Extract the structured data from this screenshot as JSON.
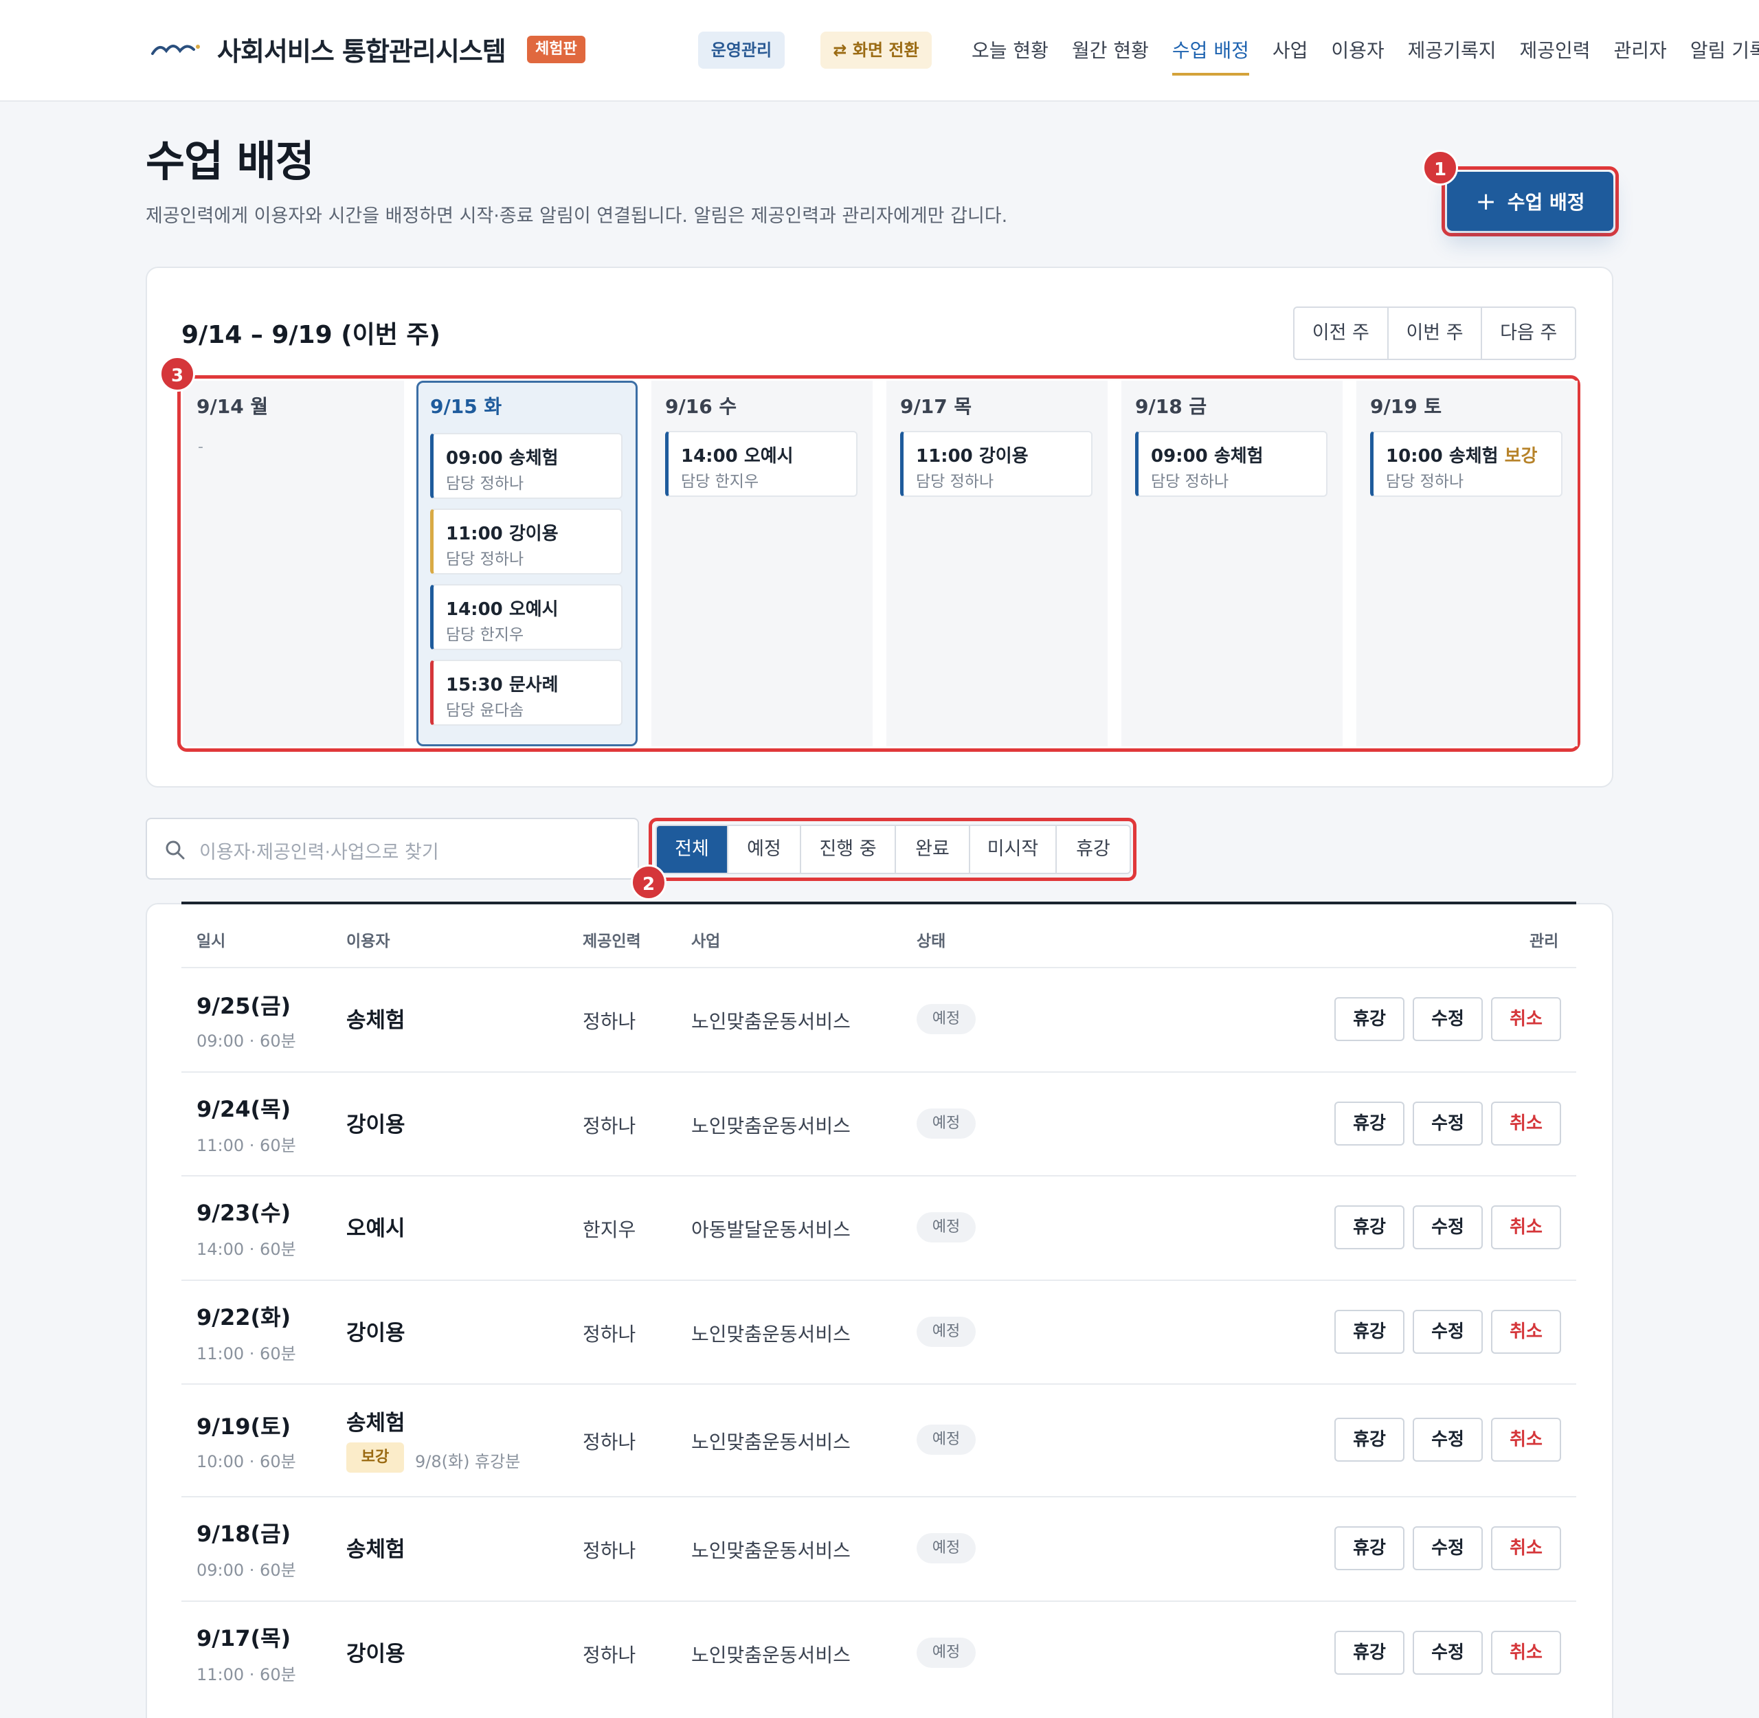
{
  "header": {
    "app_title": "사회서비스 통합관리시스템",
    "demo_badge": "체험판",
    "ops_label": "운영관리",
    "switch_label": "⇄ 화면 전환",
    "nav": [
      {
        "label": "오늘 현황",
        "active": false
      },
      {
        "label": "월간 현황",
        "active": false
      },
      {
        "label": "수업 배정",
        "active": true
      },
      {
        "label": "사업",
        "active": false
      },
      {
        "label": "이용자",
        "active": false
      },
      {
        "label": "제공기록지",
        "active": false
      },
      {
        "label": "제공인력",
        "active": false
      },
      {
        "label": "관리자",
        "active": false
      },
      {
        "label": "알림 기록",
        "active": false
      }
    ]
  },
  "page": {
    "title": "수업 배정",
    "description": "제공인력에게 이용자와 시간을 배정하면 시작·종료 알림이 연결됩니다. 알림은 제공인력과 관리자에게만 갑니다.",
    "add_button_icon": "+",
    "add_button_label": "수업 배정"
  },
  "markers": [
    "1",
    "2",
    "3"
  ],
  "calendar": {
    "week_title": "9/14 – 9/19 (이번 주)",
    "nav": [
      "이전 주",
      "이번 주",
      "다음 주"
    ],
    "days": [
      {
        "label": "9/14 월",
        "today": false,
        "empty": "-",
        "classes": []
      },
      {
        "label": "9/15 화",
        "today": true,
        "classes": [
          {
            "time": "09:00 송체험",
            "staff": "담당 정하나",
            "accent": "#1e5b9c"
          },
          {
            "time": "11:00 강이용",
            "staff": "담당 정하나",
            "accent": "#d9aa45"
          },
          {
            "time": "14:00 오예시",
            "staff": "담당 한지우",
            "accent": "#1e5b9c"
          },
          {
            "time": "15:30 문사례",
            "staff": "담당 윤다솜",
            "accent": "#d5363a"
          }
        ]
      },
      {
        "label": "9/16 수",
        "today": false,
        "classes": [
          {
            "time": "14:00 오예시",
            "staff": "담당 한지우",
            "accent": "#1e5b9c"
          }
        ]
      },
      {
        "label": "9/17 목",
        "today": false,
        "classes": [
          {
            "time": "11:00 강이용",
            "staff": "담당 정하나",
            "accent": "#1e5b9c"
          }
        ]
      },
      {
        "label": "9/18 금",
        "today": false,
        "classes": [
          {
            "time": "09:00 송체험",
            "staff": "담당 정하나",
            "accent": "#1e5b9c"
          }
        ]
      },
      {
        "label": "9/19 토",
        "today": false,
        "classes": [
          {
            "time": "10:00 송체험",
            "tag": "보강",
            "staff": "담당 정하나",
            "accent": "#1e5b9c"
          }
        ]
      }
    ]
  },
  "search": {
    "placeholder": "이용자·제공인력·사업으로 찾기"
  },
  "filters": [
    {
      "label": "전체",
      "active": true
    },
    {
      "label": "예정",
      "active": false
    },
    {
      "label": "진행 중",
      "active": false
    },
    {
      "label": "완료",
      "active": false
    },
    {
      "label": "미시작",
      "active": false
    },
    {
      "label": "휴강",
      "active": false
    }
  ],
  "table": {
    "headers": {
      "date": "일시",
      "user": "이용자",
      "provider": "제공인력",
      "business": "사업",
      "status": "상태",
      "manage": "관리"
    },
    "actions": {
      "leave": "휴강",
      "edit": "수정",
      "cancel": "취소"
    },
    "rows": [
      {
        "date": "9/25(금)",
        "time": "09:00 · 60분",
        "user": "송체험",
        "provider": "정하나",
        "business": "노인맞춤운동서비스",
        "status": "예정"
      },
      {
        "date": "9/24(목)",
        "time": "11:00 · 60분",
        "user": "강이용",
        "provider": "정하나",
        "business": "노인맞춤운동서비스",
        "status": "예정"
      },
      {
        "date": "9/23(수)",
        "time": "14:00 · 60분",
        "user": "오예시",
        "provider": "한지우",
        "business": "아동발달운동서비스",
        "status": "예정"
      },
      {
        "date": "9/22(화)",
        "time": "11:00 · 60분",
        "user": "강이용",
        "provider": "정하나",
        "business": "노인맞춤운동서비스",
        "status": "예정"
      },
      {
        "date": "9/19(토)",
        "time": "10:00 · 60분",
        "user": "송체험",
        "makeup_badge": "보강",
        "makeup_note": "9/8(화) 휴강분",
        "provider": "정하나",
        "business": "노인맞춤운동서비스",
        "status": "예정"
      },
      {
        "date": "9/18(금)",
        "time": "09:00 · 60분",
        "user": "송체험",
        "provider": "정하나",
        "business": "노인맞춤운동서비스",
        "status": "예정"
      },
      {
        "date": "9/17(목)",
        "time": "11:00 · 60분",
        "user": "강이용",
        "provider": "정하나",
        "business": "노인맞춤운동서비스",
        "status": "예정"
      }
    ]
  }
}
